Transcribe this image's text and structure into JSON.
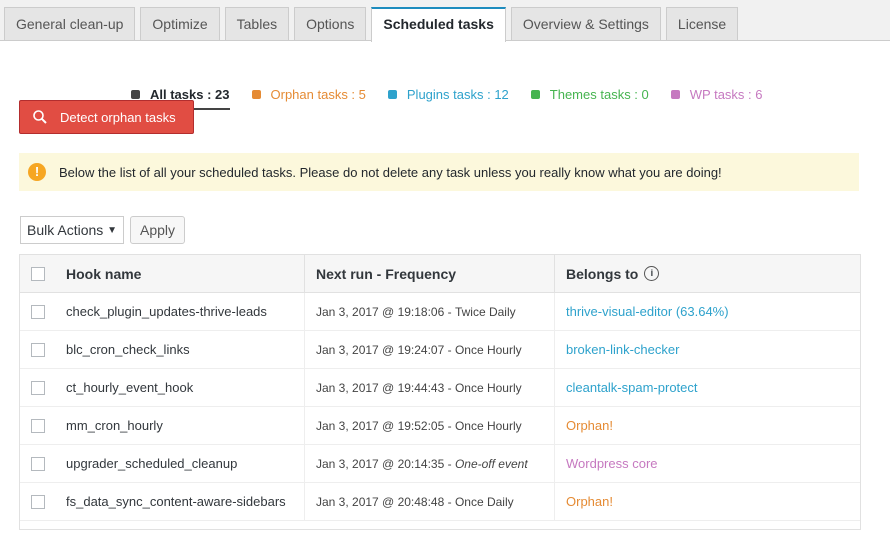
{
  "tabs": [
    {
      "label": "General clean-up",
      "active": false
    },
    {
      "label": "Optimize",
      "active": false
    },
    {
      "label": "Tables",
      "active": false
    },
    {
      "label": "Options",
      "active": false
    },
    {
      "label": "Scheduled tasks",
      "active": true
    },
    {
      "label": "Overview & Settings",
      "active": false
    },
    {
      "label": "License",
      "active": false
    }
  ],
  "filters": [
    {
      "label": "All tasks : 23",
      "color": "#444444"
    },
    {
      "label": "Orphan tasks : 5",
      "color": "#e58b34"
    },
    {
      "label": "Plugins tasks : 12",
      "color": "#2ea2cc"
    },
    {
      "label": "Themes tasks : 0",
      "color": "#46b450"
    },
    {
      "label": "WP tasks : 6",
      "color": "#c679c0"
    }
  ],
  "detect_button": {
    "label": "Detect orphan tasks",
    "icon": "search-icon"
  },
  "notice": {
    "icon": "warning-icon",
    "text": "Below the list of all your scheduled tasks. Please do not delete any task unless you really know what you are doing!"
  },
  "bulk": {
    "label": "Bulk Actions",
    "apply_label": "Apply"
  },
  "table": {
    "headers": {
      "hook": "Hook name",
      "next_run_a": "Next run",
      "next_run_b": " - Frequency",
      "belongs": "Belongs to"
    },
    "rows": [
      {
        "hook": "check_plugin_updates-thrive-leads",
        "run": "Jan 3, 2017 @ 19:18:06",
        "freq": "Twice Daily",
        "belongs": "thrive-visual-editor (63.64%)",
        "kind": "plugin"
      },
      {
        "hook": "blc_cron_check_links",
        "run": "Jan 3, 2017 @ 19:24:07",
        "freq": "Once Hourly",
        "belongs": "broken-link-checker",
        "kind": "plugin"
      },
      {
        "hook": "ct_hourly_event_hook",
        "run": "Jan 3, 2017 @ 19:44:43",
        "freq": "Once Hourly",
        "belongs": "cleantalk-spam-protect",
        "kind": "plugin"
      },
      {
        "hook": "mm_cron_hourly",
        "run": "Jan 3, 2017 @ 19:52:05",
        "freq": "Once Hourly",
        "belongs": "Orphan!",
        "kind": "orphan"
      },
      {
        "hook": "upgrader_scheduled_cleanup",
        "run": "Jan 3, 2017 @ 20:14:35",
        "freq": "One-off event",
        "belongs": "Wordpress core",
        "kind": "core"
      },
      {
        "hook": "fs_data_sync_content-aware-sidebars",
        "run": "Jan 3, 2017 @ 20:48:48",
        "freq": "Once Daily",
        "belongs": "Orphan!",
        "kind": "orphan"
      }
    ]
  },
  "run_separator": " - "
}
